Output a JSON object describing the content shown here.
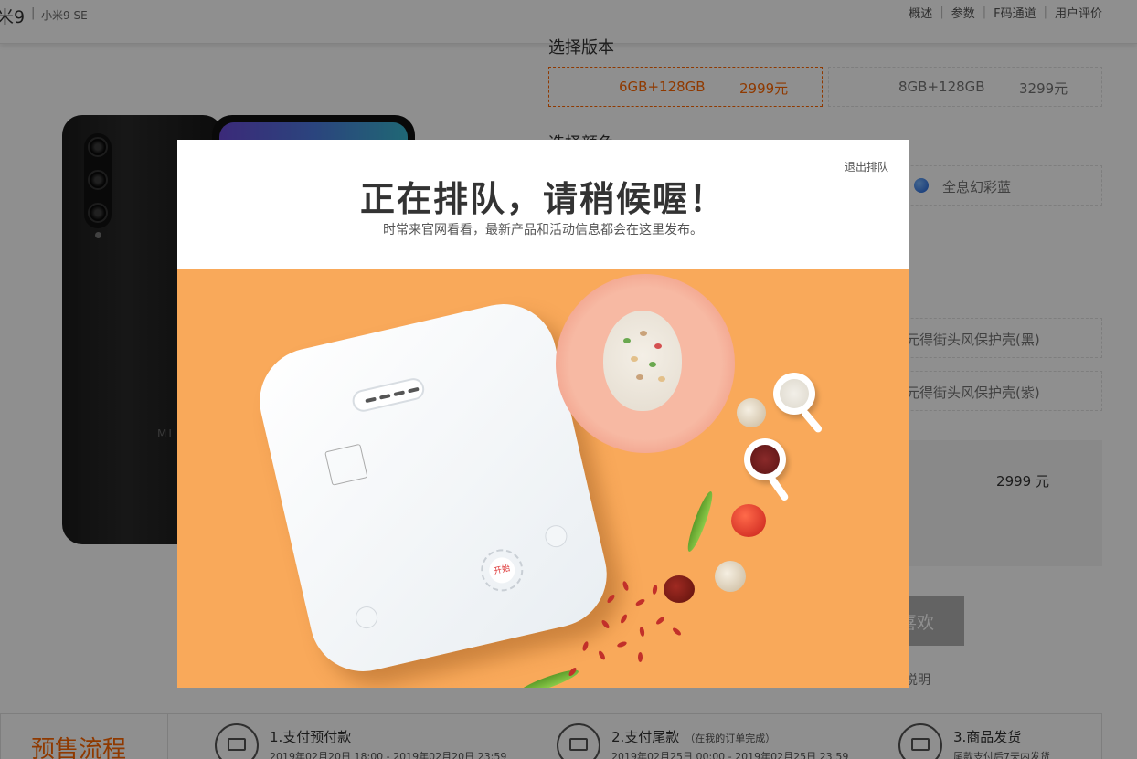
{
  "header": {
    "product_name": "米9",
    "separator": "|",
    "related_product": "小米9 SE",
    "nav": [
      "概述",
      "参数",
      "F码通道",
      "用户评价"
    ],
    "nav_separator": "|"
  },
  "product_image": {
    "logo_text": "MI"
  },
  "options": {
    "version_heading": "选择版本",
    "versions": [
      {
        "label": "6GB+128GB",
        "price": "2999元",
        "selected": true
      },
      {
        "label": "8GB+128GB",
        "price": "3299元",
        "selected": false
      }
    ],
    "color_heading": "选择颜色",
    "colors": [
      {
        "label": "全息幻彩蓝",
        "swatch": "#2f74e0"
      }
    ],
    "accessories": [
      {
        "label": "元得街头风保护壳(黑)"
      },
      {
        "label": "元得街头风保护壳(紫)"
      }
    ]
  },
  "summary": {
    "price": "2999 元"
  },
  "actions": {
    "like_label": "喜欢",
    "note": "说明"
  },
  "presale": {
    "title": "预售流程",
    "steps": [
      {
        "title": "1.支付预付款",
        "note": "",
        "date": "2019年02月20日 18:00 - 2019年02月20日 23:59"
      },
      {
        "title": "2.支付尾款",
        "note": "（在我的订单完成）",
        "date": "2019年02月25日 00:00 - 2019年02月25日 23:59"
      },
      {
        "title": "3.商品发货",
        "note": "",
        "date": "尾款支付后7天内发货"
      }
    ]
  },
  "modal": {
    "exit_label": "退出排队",
    "title": "正在排队，请稍候喔！",
    "subtitle": "时常来官网看看，最新产品和活动信息都会在这里发布。",
    "promo": {
      "start_button_text": "开始"
    }
  },
  "colors": {
    "accent": "#ff6700",
    "promo_bg": "#f9a95a",
    "overlay": "rgba(0,0,0,0.44)"
  }
}
